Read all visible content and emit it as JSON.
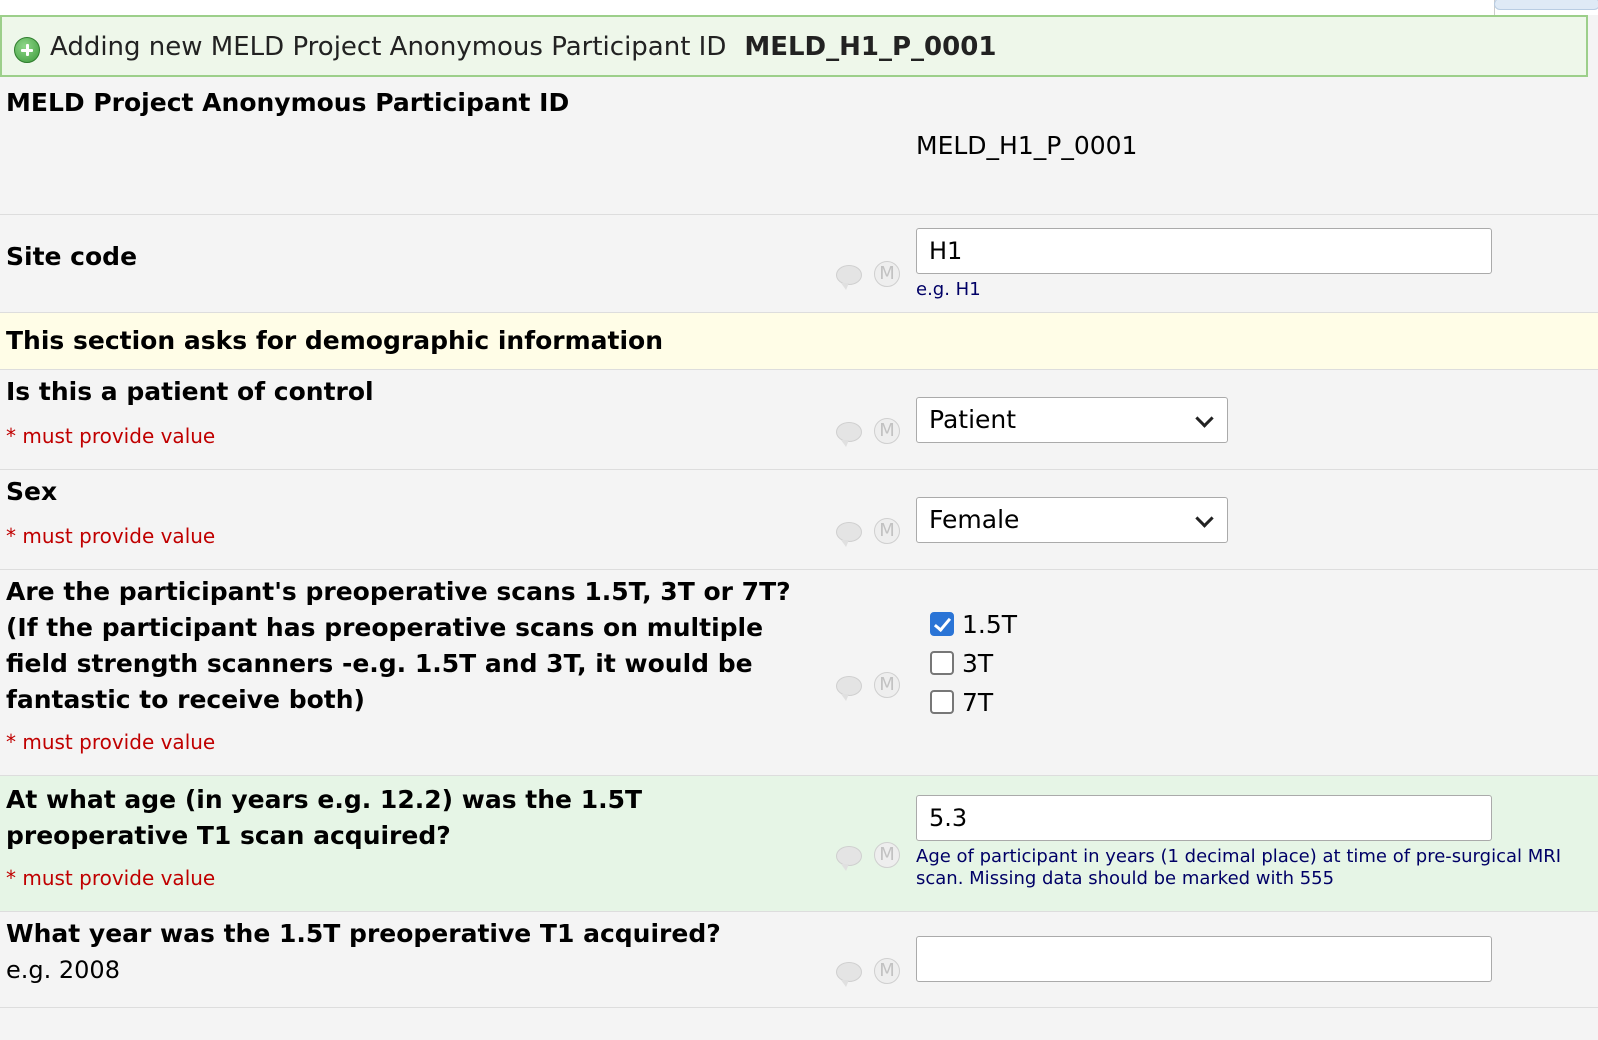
{
  "header": {
    "title": "Adding new MELD Project Anonymous Participant ID",
    "record_id": "MELD_H1_P_0001"
  },
  "fields": {
    "participant_id": {
      "label": "MELD Project Anonymous Participant ID",
      "value": "MELD_H1_P_0001"
    },
    "site_code": {
      "label": "Site code",
      "value": "H1",
      "hint": "e.g. H1"
    },
    "section_header": "This section asks for demographic information",
    "patient_control": {
      "label": "Is this a patient of control",
      "required": "* must provide value",
      "selected": "Patient"
    },
    "sex": {
      "label": "Sex",
      "required": "* must provide value",
      "selected": "Female"
    },
    "scan_strength": {
      "label": "Are the participant's preoperative scans 1.5T, 3T or 7T? (If the participant has preoperative scans on multiple field strength scanners -e.g. 1.5T and 3T, it would be fantastic to receive both)",
      "required": "* must provide value",
      "options": [
        {
          "label": "1.5T",
          "checked": true
        },
        {
          "label": "3T",
          "checked": false
        },
        {
          "label": "7T",
          "checked": false
        }
      ]
    },
    "age_at_scan": {
      "label": "At what age (in years e.g. 12.2) was the 1.5T preoperative T1 scan acquired?",
      "required": "* must provide value",
      "value": "5.3",
      "hint": "Age of participant in years (1 decimal place) at time of pre-surgical MRI scan. Missing data should be marked with 555"
    },
    "scan_year": {
      "label": "What year was the 1.5T preoperative T1 acquired?",
      "note": "e.g. 2008",
      "value": ""
    }
  },
  "icons": {
    "comment": "comment-bubble-icon",
    "missing": "missing-data-m-icon"
  }
}
